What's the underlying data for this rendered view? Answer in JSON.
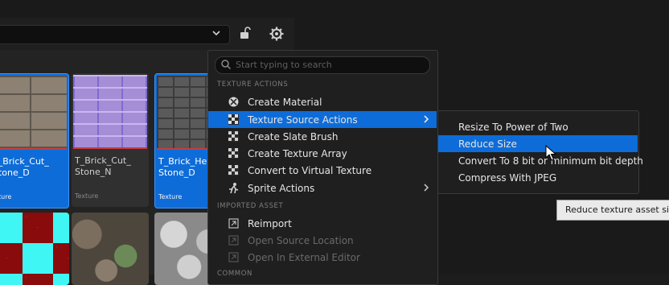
{
  "colors": {
    "accent": "#0e6cd8",
    "menu_bg": "#1f1f1f",
    "section_text": "#7d7d7d",
    "tooltip_bg": "#eaeaea"
  },
  "toolbar": {
    "icons": [
      "chevron-down-icon",
      "lock-icon",
      "gear-icon"
    ]
  },
  "assets": [
    {
      "name": "T_Brick_Cut_\nStone_D",
      "type": "Texture",
      "selected": true,
      "thumb": "brick"
    },
    {
      "name": "T_Brick_Cut_\nStone_N",
      "type": "Texture",
      "selected": false,
      "thumb": "normal"
    },
    {
      "name": "T_Brick_Hew\nStone_D",
      "type": "Texture",
      "selected": true,
      "thumb": "hewn"
    }
  ],
  "assets_row2": [
    "checker",
    "cobble",
    "pebble"
  ],
  "context_menu": {
    "search_placeholder": "Start typing to search",
    "sections": {
      "texture_actions": "TEXTURE ACTIONS",
      "imported_asset": "IMPORTED ASSET",
      "common": "COMMON"
    },
    "items": [
      {
        "label": "Create Material",
        "icon": "material-sphere-icon",
        "enabled": true
      },
      {
        "label": "Texture Source Actions",
        "icon": "checker-icon",
        "enabled": true,
        "highlighted": true,
        "submenu": true
      },
      {
        "label": "Create Slate Brush",
        "icon": "checker-icon",
        "enabled": true
      },
      {
        "label": "Create Texture Array",
        "icon": "checker-icon",
        "enabled": true
      },
      {
        "label": "Convert to Virtual Texture",
        "icon": "checker-icon",
        "enabled": true
      },
      {
        "label": "Sprite Actions",
        "icon": "sprite-icon",
        "enabled": true,
        "submenu": true
      }
    ],
    "imported_items": [
      {
        "label": "Reimport",
        "icon": "reimport-icon",
        "enabled": true
      },
      {
        "label": "Open Source Location",
        "icon": "folder-open-icon",
        "enabled": false
      },
      {
        "label": "Open In External Editor",
        "icon": "external-editor-icon",
        "enabled": false
      }
    ]
  },
  "submenu": {
    "items": [
      {
        "label": "Resize To Power of Two",
        "highlighted": false
      },
      {
        "label": "Reduce Size",
        "highlighted": true
      },
      {
        "label": "Convert To 8 bit or minimum bit depth",
        "highlighted": false
      },
      {
        "label": "Compress With JPEG",
        "highlighted": false
      }
    ]
  },
  "tooltip": {
    "text": "Reduce texture asset siz"
  }
}
